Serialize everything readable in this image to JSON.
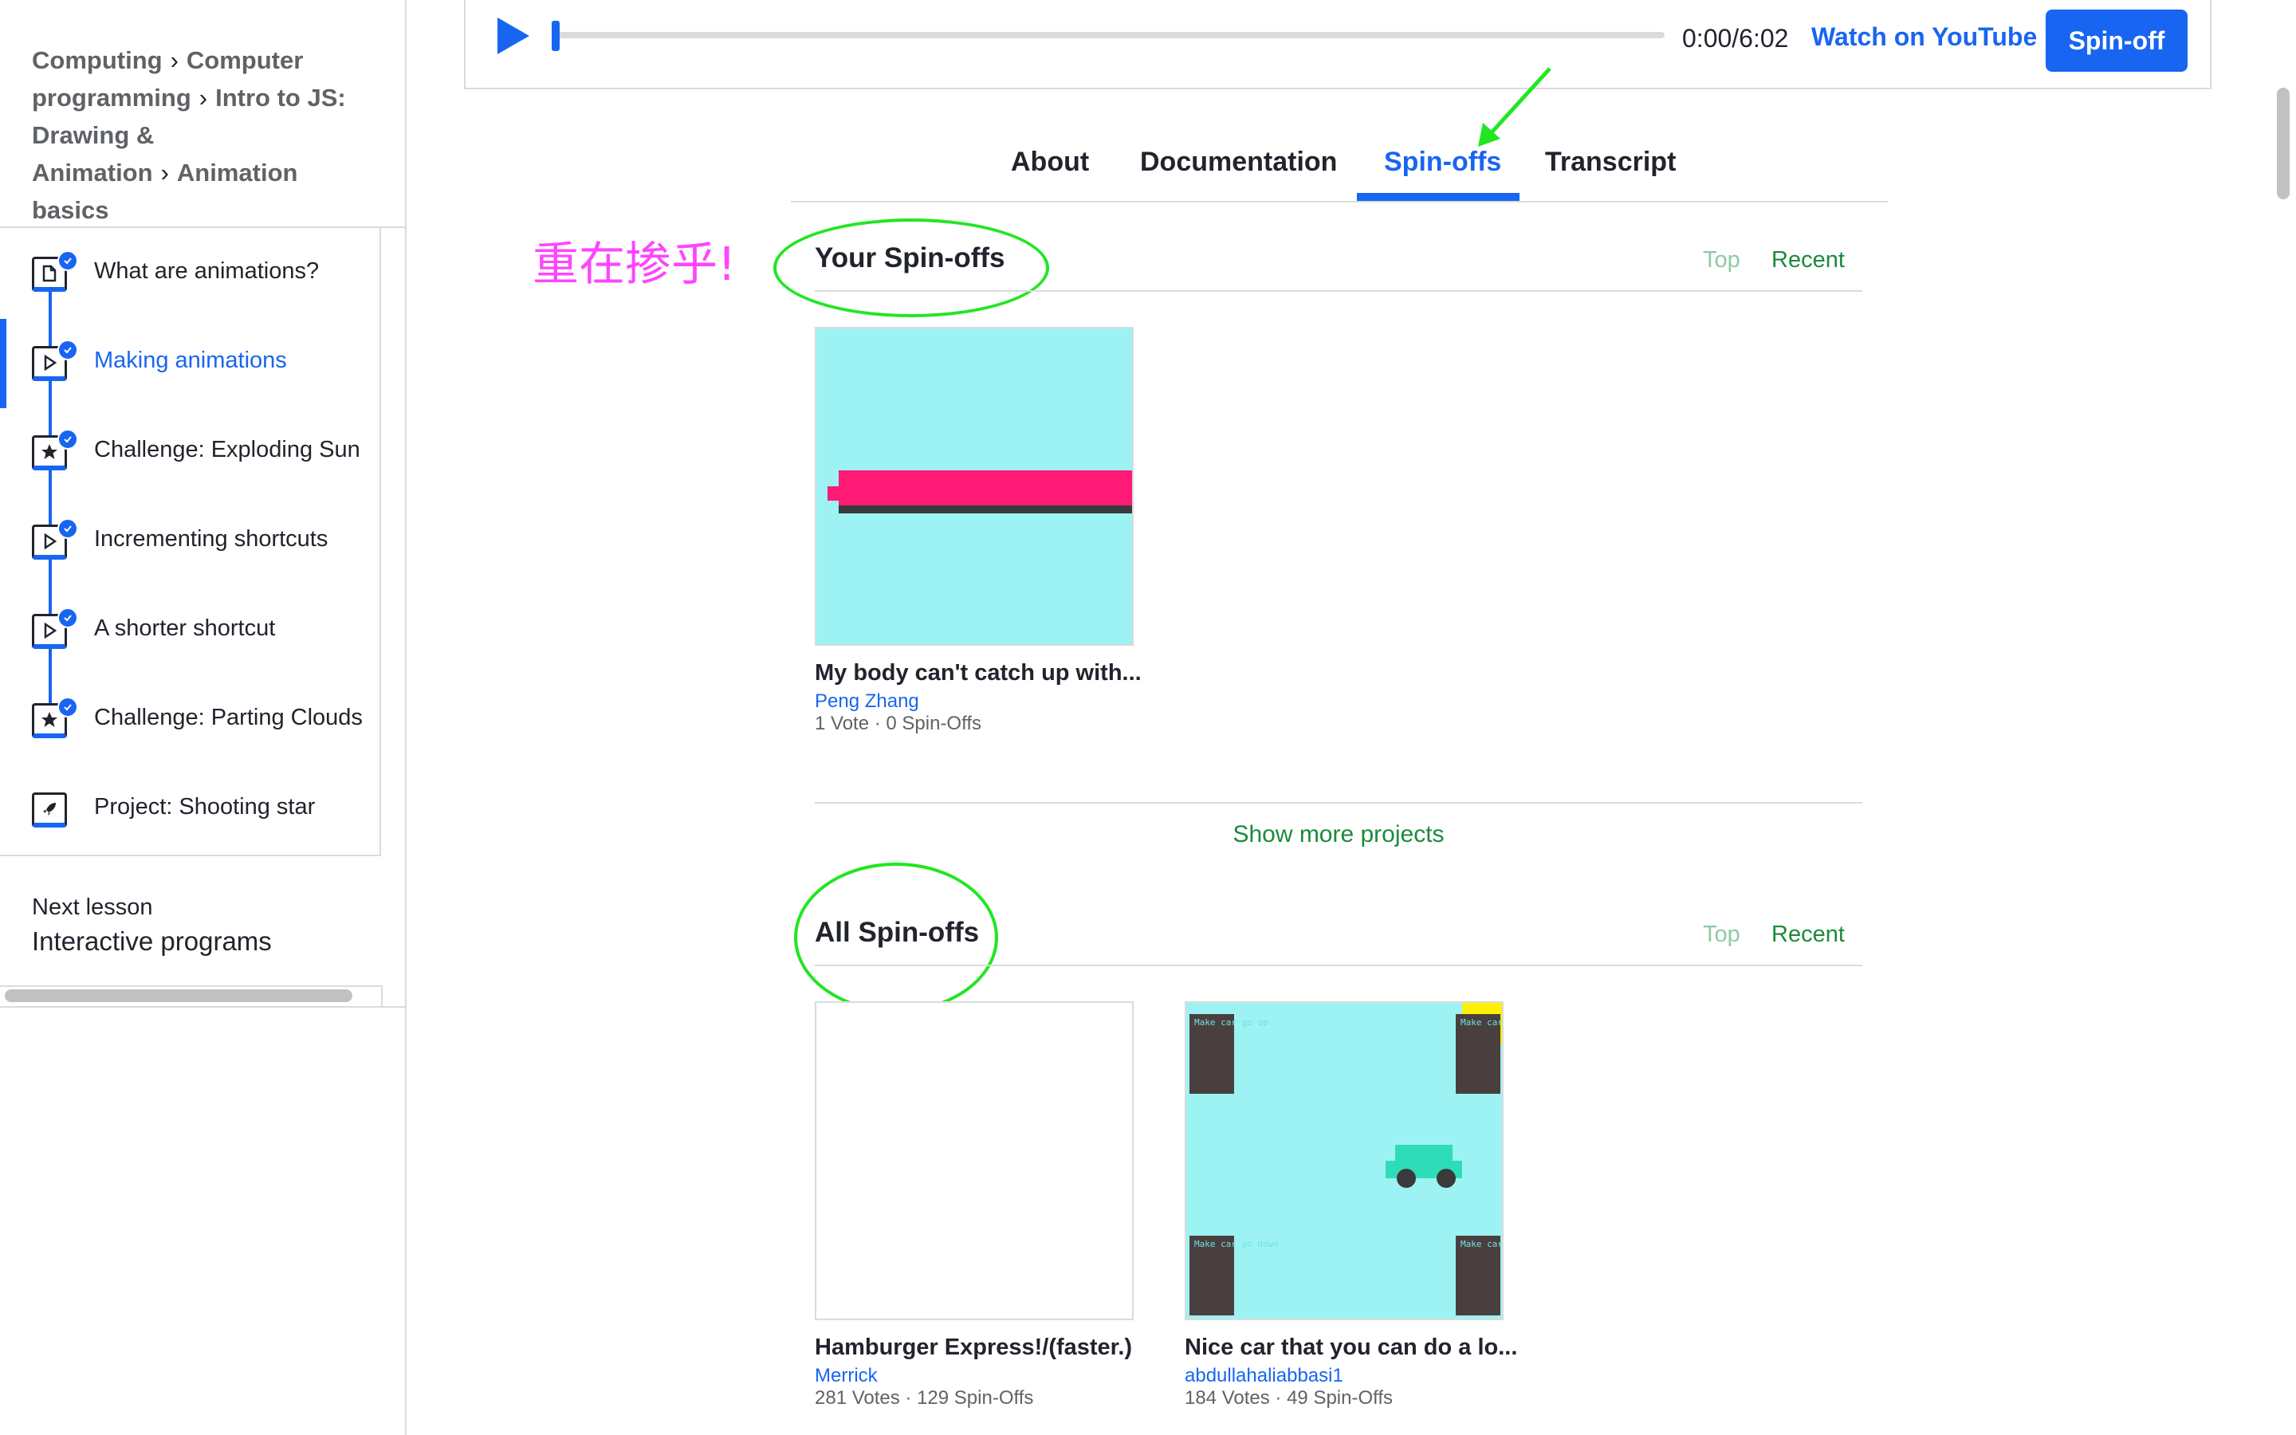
{
  "breadcrumb": {
    "items": [
      "Computing",
      "Computer programming",
      "Intro to JS: Drawing & Animation",
      "Animation basics"
    ],
    "separator": "›"
  },
  "lessons": [
    {
      "label": "What are animations?",
      "icon": "article-icon",
      "completed": true,
      "active": false
    },
    {
      "label": "Making animations",
      "icon": "play-icon",
      "completed": true,
      "active": true
    },
    {
      "label": "Challenge: Exploding Sun",
      "icon": "star-icon",
      "completed": true,
      "active": false
    },
    {
      "label": "Incrementing shortcuts",
      "icon": "play-icon",
      "completed": true,
      "active": false
    },
    {
      "label": "A shorter shortcut",
      "icon": "play-icon",
      "completed": true,
      "active": false
    },
    {
      "label": "Challenge: Parting Clouds",
      "icon": "star-icon",
      "completed": true,
      "active": false
    },
    {
      "label": "Project: Shooting star",
      "icon": "rocket-icon",
      "completed": false,
      "active": false
    }
  ],
  "next_lesson": {
    "caption": "Next lesson",
    "title": "Interactive programs"
  },
  "video": {
    "time": "0:00/6:02",
    "youtube_link": "Watch on YouTube",
    "spinoff_button": "Spin-off",
    "progress": 0
  },
  "tabs": [
    {
      "label": "About",
      "selected": false
    },
    {
      "label": "Documentation",
      "selected": false
    },
    {
      "label": "Spin-offs",
      "selected": true
    },
    {
      "label": "Transcript",
      "selected": false
    }
  ],
  "annotation": {
    "note": "重在掺乎!",
    "color": "#ff44ff",
    "circle_color": "#22e622"
  },
  "your_spinoffs": {
    "title": "Your Spin-offs",
    "sort_top": "Top",
    "sort_recent": "Recent",
    "projects": [
      {
        "title": "My body can't catch up with...",
        "author": "Peng Zhang",
        "stats": "1 Vote · 0 Spin-Offs"
      }
    ]
  },
  "show_more": "Show more projects",
  "all_spinoffs": {
    "title": "All Spin-offs",
    "sort_top": "Top",
    "sort_recent": "Recent",
    "projects": [
      {
        "title": "Hamburger Express!/(faster.)",
        "author": "Merrick",
        "stats": "281 Votes · 129 Spin-Offs"
      },
      {
        "title": "Nice car that you can do a lo...",
        "author": "abdullahaliabbasi1",
        "stats": "184 Votes · 49 Spin-Offs",
        "thumb_labels": [
          "Make car go up",
          "Make car fast",
          "Make car go down",
          "Make car slow"
        ]
      }
    ]
  },
  "colors": {
    "accent": "#1865f2",
    "green": "#1b8a3a",
    "thumb_bg": "#9df3f3",
    "bar_pink": "#ff1a75"
  }
}
